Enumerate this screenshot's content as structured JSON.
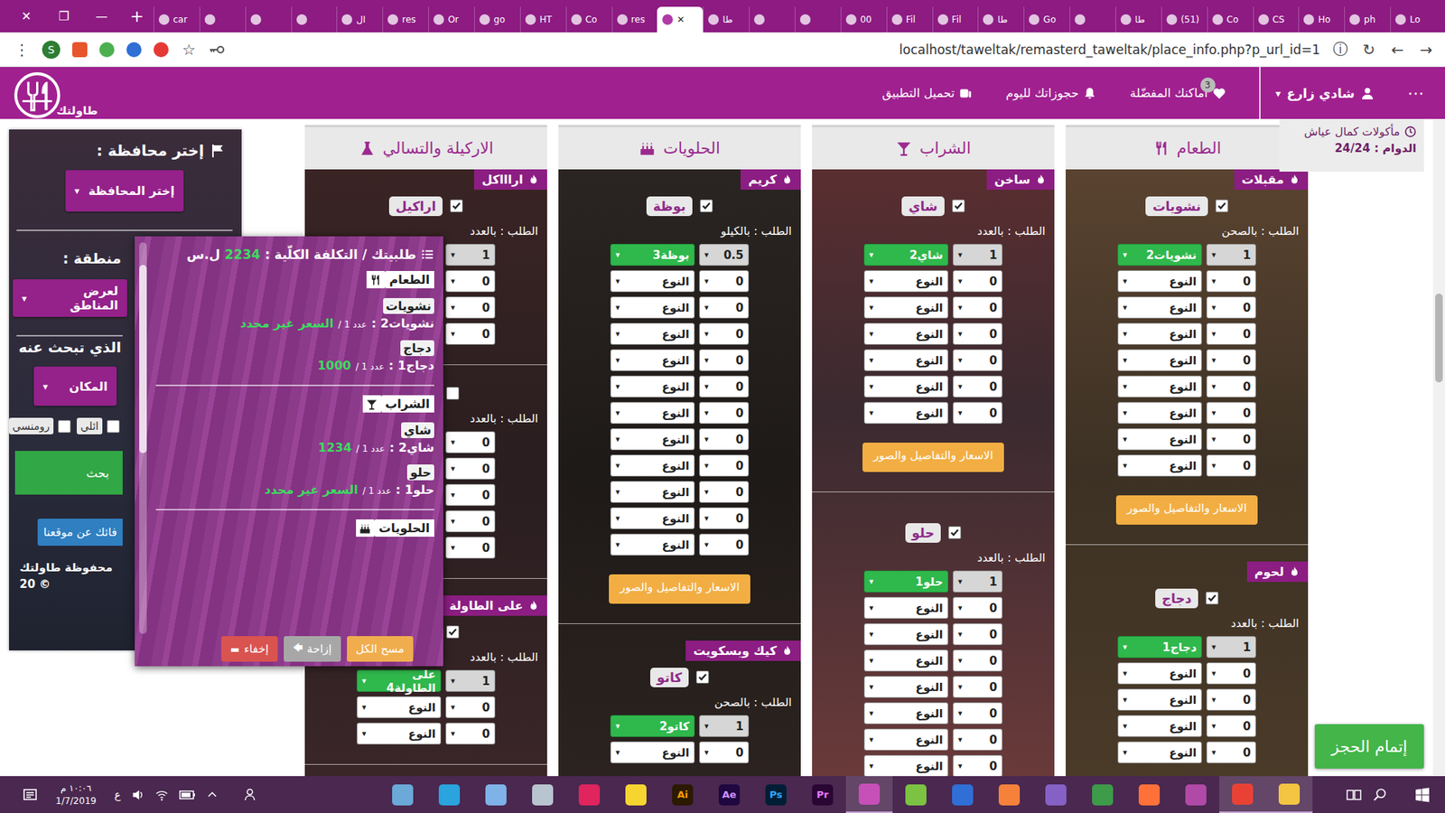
{
  "browser": {
    "window_controls": [
      "✕",
      "❐",
      "—"
    ],
    "new_tab": "+",
    "tabs": [
      {
        "label": "car",
        "selected": false
      },
      {
        "label": "",
        "selected": false
      },
      {
        "label": "",
        "selected": false
      },
      {
        "label": "",
        "selected": false
      },
      {
        "label": "ال",
        "selected": false
      },
      {
        "label": "res",
        "selected": false
      },
      {
        "label": "Or",
        "selected": false
      },
      {
        "label": "go",
        "selected": false
      },
      {
        "label": "HT",
        "selected": false
      },
      {
        "label": "Co",
        "selected": false
      },
      {
        "label": "res",
        "selected": false
      },
      {
        "label": "",
        "selected": true
      },
      {
        "label": "طا",
        "selected": false
      },
      {
        "label": "",
        "selected": false
      },
      {
        "label": "",
        "selected": false
      },
      {
        "label": "00",
        "selected": false
      },
      {
        "label": "Fil",
        "selected": false
      },
      {
        "label": "Fil",
        "selected": false
      },
      {
        "label": "طا",
        "selected": false
      },
      {
        "label": "Go",
        "selected": false
      },
      {
        "label": "",
        "selected": false
      },
      {
        "label": "طا",
        "selected": false
      },
      {
        "label": "(51)",
        "selected": false
      },
      {
        "label": "Co",
        "selected": false
      },
      {
        "label": "CS",
        "selected": false
      },
      {
        "label": "Ho",
        "selected": false
      },
      {
        "label": "ph",
        "selected": false
      },
      {
        "label": "Lo",
        "selected": false
      }
    ],
    "tab_close": "✕",
    "menu": "⋮",
    "profile": "S",
    "star": "☆",
    "address": "localhost/taweltak/remasterd_taweltak/place_info.php?p_url_id=1",
    "nav_buttons": [
      "ⓘ",
      "↻",
      "←",
      "→"
    ]
  },
  "glyphs": {
    "caret": "▾"
  },
  "header": {
    "logo": "طاولتك",
    "menu": "⋯",
    "user": "شادي زارع",
    "nav": [
      {
        "label": "اماكنك المفضّلة",
        "badge": "3"
      },
      {
        "label": "حجوزاتك لليوم"
      },
      {
        "label": "تحميل التطبيق"
      }
    ]
  },
  "place": {
    "name": "مأكولات كمال عياش",
    "hours": "الدوام : 24/24"
  },
  "sidebar": {
    "governorate_label": "إختر محافظة :",
    "governorate_button": "إختر المحافظة",
    "area_label": "منطقة :",
    "area_button": "لعرض المناطق",
    "search_label": "الذي تبحث عنه",
    "place_button": "المكان",
    "tags": [
      {
        "label": "ائلي",
        "checked": false
      },
      {
        "label": "رومنسي",
        "checked": false
      }
    ],
    "search_button": "بحث",
    "about_button": "فائك عن موقعنا",
    "footer": "محفوظة طاولتك",
    "copyright": "© 20"
  },
  "columns": [
    {
      "title": "الطعام",
      "sections": [
        {
          "category": "مقبلات",
          "items": [
            {
              "name": "نشويات",
              "checked": true,
              "order": "الطلب : بالصحن",
              "rows": [
                {
                  "qty": "1",
                  "type": "نشويات2",
                  "selected": true
                },
                {
                  "qty": "0",
                  "type": "النوع",
                  "selected": false
                },
                {
                  "qty": "0",
                  "type": "النوع",
                  "selected": false
                },
                {
                  "qty": "0",
                  "type": "النوع",
                  "selected": false
                },
                {
                  "qty": "0",
                  "type": "النوع",
                  "selected": false
                },
                {
                  "qty": "0",
                  "type": "النوع",
                  "selected": false
                },
                {
                  "qty": "0",
                  "type": "النوع",
                  "selected": false
                },
                {
                  "qty": "0",
                  "type": "النوع",
                  "selected": false
                },
                {
                  "qty": "0",
                  "type": "النوع",
                  "selected": false
                }
              ],
              "button": "الاسعار والتفاصيل والصور"
            }
          ]
        },
        {
          "category": "لحوم",
          "items": [
            {
              "name": "دجاج",
              "checked": true,
              "order": "الطلب : بالعدد",
              "rows": [
                {
                  "qty": "1",
                  "type": "دجاج1",
                  "selected": true
                },
                {
                  "qty": "0",
                  "type": "النوع",
                  "selected": false
                },
                {
                  "qty": "0",
                  "type": "النوع",
                  "selected": false
                },
                {
                  "qty": "0",
                  "type": "النوع",
                  "selected": false
                },
                {
                  "qty": "0",
                  "type": "النوع",
                  "selected": false
                }
              ]
            }
          ]
        }
      ]
    },
    {
      "title": "الشراب",
      "sections": [
        {
          "category": "ساخن",
          "items": [
            {
              "name": "شاي",
              "checked": true,
              "order": "الطلب : بالعدد",
              "rows": [
                {
                  "qty": "1",
                  "type": "شاي2",
                  "selected": true
                },
                {
                  "qty": "0",
                  "type": "النوع",
                  "selected": false
                },
                {
                  "qty": "0",
                  "type": "النوع",
                  "selected": false
                },
                {
                  "qty": "0",
                  "type": "النوع",
                  "selected": false
                },
                {
                  "qty": "0",
                  "type": "النوع",
                  "selected": false
                },
                {
                  "qty": "0",
                  "type": "النوع",
                  "selected": false
                },
                {
                  "qty": "0",
                  "type": "النوع",
                  "selected": false
                }
              ],
              "button": "الاسعار والتفاصيل والصور"
            }
          ]
        },
        {
          "category": "",
          "items": [
            {
              "name": "حلو",
              "checked": true,
              "order": "الطلب : بالعدد",
              "rows": [
                {
                  "qty": "1",
                  "type": "حلو1",
                  "selected": true
                },
                {
                  "qty": "0",
                  "type": "النوع",
                  "selected": false
                },
                {
                  "qty": "0",
                  "type": "النوع",
                  "selected": false
                },
                {
                  "qty": "0",
                  "type": "النوع",
                  "selected": false
                },
                {
                  "qty": "0",
                  "type": "النوع",
                  "selected": false
                },
                {
                  "qty": "0",
                  "type": "النوع",
                  "selected": false
                },
                {
                  "qty": "0",
                  "type": "النوع",
                  "selected": false
                },
                {
                  "qty": "0",
                  "type": "النوع",
                  "selected": false
                }
              ]
            }
          ]
        }
      ]
    },
    {
      "title": "الحلويات",
      "sections": [
        {
          "category": "كريم",
          "items": [
            {
              "name": "بوظة",
              "checked": true,
              "order": "الطلب : بالكيلو",
              "rows": [
                {
                  "qty": "0.5",
                  "type": "بوظة3",
                  "selected": true
                },
                {
                  "qty": "0",
                  "type": "النوع",
                  "selected": false
                },
                {
                  "qty": "0",
                  "type": "النوع",
                  "selected": false
                },
                {
                  "qty": "0",
                  "type": "النوع",
                  "selected": false
                },
                {
                  "qty": "0",
                  "type": "النوع",
                  "selected": false
                },
                {
                  "qty": "0",
                  "type": "النوع",
                  "selected": false
                },
                {
                  "qty": "0",
                  "type": "النوع",
                  "selected": false
                },
                {
                  "qty": "0",
                  "type": "النوع",
                  "selected": false
                },
                {
                  "qty": "0",
                  "type": "النوع",
                  "selected": false
                },
                {
                  "qty": "0",
                  "type": "النوع",
                  "selected": false
                },
                {
                  "qty": "0",
                  "type": "النوع",
                  "selected": false
                },
                {
                  "qty": "0",
                  "type": "النوع",
                  "selected": false
                }
              ],
              "button": "الاسعار والتفاصيل والصور"
            }
          ]
        },
        {
          "category": "كيك وبسكويت",
          "items": [
            {
              "name": "كاتو",
              "checked": true,
              "order": "الطلب : بالصحن",
              "rows": [
                {
                  "qty": "1",
                  "type": "كاتو2",
                  "selected": true
                },
                {
                  "qty": "0",
                  "type": "النوع",
                  "selected": false
                }
              ]
            }
          ]
        }
      ]
    },
    {
      "title": "الاركيلة والتسالي",
      "sections": [
        {
          "category": "اراااكل",
          "items": [
            {
              "name": "اراكيل",
              "checked": true,
              "order": "الطلب : بالعدد",
              "rows": [
                {
                  "qty": "1",
                  "selected": true
                },
                {
                  "qty": "0",
                  "selected": false
                },
                {
                  "qty": "0",
                  "selected": false
                },
                {
                  "qty": "0",
                  "selected": false
                }
              ]
            },
            {
              "checked": false,
              "order": "الطلب : بالعدد",
              "rows": [
                {
                  "qty": "0",
                  "selected": false
                },
                {
                  "qty": "0",
                  "selected": false
                },
                {
                  "qty": "0",
                  "selected": false
                },
                {
                  "qty": "0",
                  "selected": false
                },
                {
                  "qty": "0",
                  "selected": false
                }
              ]
            }
          ]
        },
        {
          "category": "على الطاولة",
          "items": [
            {
              "checked": true,
              "order": "الطلب : بالعدد",
              "rows": [
                {
                  "qty": "1",
                  "type": "على الطاولة4",
                  "selected": true
                },
                {
                  "qty": "0",
                  "type": "النوع",
                  "selected": false
                },
                {
                  "qty": "0",
                  "type": "النوع",
                  "selected": false
                }
              ]
            }
          ]
        }
      ]
    }
  ],
  "order_panel": {
    "title": "طلبيتك / التكلفة الكلّية :",
    "total": "2234",
    "currency": "ل.س",
    "groups": [
      {
        "title": "الطعام",
        "items": [
          {
            "name": "نشويات",
            "lines": [
              {
                "type": "نشويات2 :",
                "count": "عدد 1 /",
                "price": "السعر غير محدد"
              }
            ]
          },
          {
            "name": "دجاج",
            "lines": [
              {
                "type": "دجاج1 :",
                "count": "عدد 1 /",
                "price": "1000"
              }
            ]
          }
        ]
      },
      {
        "title": "الشراب",
        "items": [
          {
            "name": "شاي",
            "lines": [
              {
                "type": "شاي2 :",
                "count": "عدد 1 /",
                "price": "1234"
              }
            ]
          },
          {
            "name": "حلو",
            "lines": [
              {
                "type": "حلو1 :",
                "count": "عدد 1 /",
                "price": "السعر غير محدد"
              }
            ]
          }
        ]
      },
      {
        "title": "الحلويات",
        "items": []
      }
    ],
    "buttons": [
      {
        "label": "مسح الكل",
        "glyph": "",
        "color": "#f0ad4e"
      },
      {
        "label": "إزاحة",
        "glyph": "🡄",
        "color": "#a7a7a7"
      },
      {
        "label": "إخفاء",
        "glyph": "▬",
        "color": "#d9534f"
      }
    ]
  },
  "finish_button": "إتمام الحجز",
  "taskbar": {
    "time": "١٠:٠٦ م",
    "date": "1/7/2019",
    "lang": "ع",
    "apps": [
      {
        "label": "",
        "color": "#6aa9d8",
        "fg": "#ffffff",
        "active": false
      },
      {
        "label": "",
        "color": "#2aa3de",
        "fg": "#ffffff",
        "active": false
      },
      {
        "label": "",
        "color": "#7fb3e8",
        "fg": "#ffffff",
        "active": false
      },
      {
        "label": "",
        "color": "#b8c4d0",
        "fg": "#ffffff",
        "active": false
      },
      {
        "label": "",
        "color": "#e0245e",
        "fg": "#ffffff",
        "active": false
      },
      {
        "label": "",
        "color": "#f7d531",
        "fg": "#ffffff",
        "active": false
      },
      {
        "label": "Ai",
        "color": "#2b1a00",
        "fg": "#ff9a00",
        "active": false
      },
      {
        "label": "Ae",
        "color": "#1f0740",
        "fg": "#d291ff",
        "active": false
      },
      {
        "label": "Ps",
        "color": "#001e36",
        "fg": "#31a8ff",
        "active": false
      },
      {
        "label": "Pr",
        "color": "#2a0634",
        "fg": "#ea77ff",
        "active": false
      },
      {
        "label": "",
        "color": "#c64fb8",
        "fg": "#ffffff",
        "active": true
      },
      {
        "label": "",
        "color": "#7cc243",
        "fg": "#ffffff",
        "active": false
      },
      {
        "label": "",
        "color": "#2f6fd6",
        "fg": "#ffffff",
        "active": false
      },
      {
        "label": "",
        "color": "#f5813b",
        "fg": "#ffffff",
        "active": false
      },
      {
        "label": "",
        "color": "#8661c5",
        "fg": "#ffffff",
        "active": false
      },
      {
        "label": "",
        "color": "#3d9b49",
        "fg": "#ffffff",
        "active": false
      },
      {
        "label": "",
        "color": "#ff7139",
        "fg": "#ffffff",
        "active": false
      },
      {
        "label": "",
        "color": "#b04aa6",
        "fg": "#ffffff",
        "active": false
      },
      {
        "label": "",
        "color": "#e94235",
        "fg": "#ffffff",
        "active": true
      },
      {
        "label": "",
        "color": "#f4c542",
        "fg": "#ffffff",
        "active": true
      }
    ]
  }
}
